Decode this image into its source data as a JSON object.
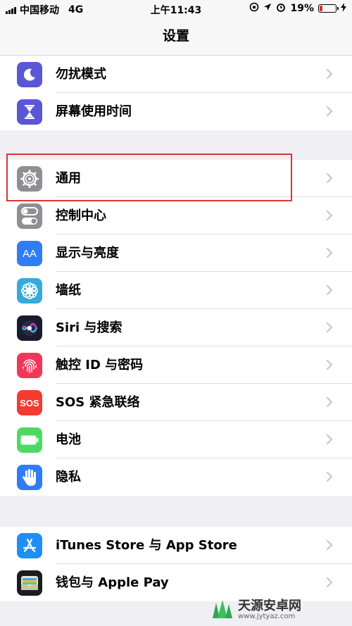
{
  "status_bar": {
    "carrier": "中国移动",
    "network": "4G",
    "time": "上午11:43",
    "battery_percent": "19%",
    "battery_level": 0.19
  },
  "nav": {
    "title": "设置"
  },
  "group1": [
    {
      "label": "勿扰模式",
      "icon": "moon-icon",
      "color": "#5a56d6"
    },
    {
      "label": "屏幕使用时间",
      "icon": "hourglass-icon",
      "color": "#5a56d6"
    }
  ],
  "group2": [
    {
      "label": "通用",
      "icon": "gear-icon",
      "color": "#8e8e93"
    },
    {
      "label": "控制中心",
      "icon": "toggles-icon",
      "color": "#8e8e93"
    },
    {
      "label": "显示与亮度",
      "icon": "text-size-icon",
      "color": "#2f7cf6",
      "icon_text": "AA"
    },
    {
      "label": "墙纸",
      "icon": "flower-icon",
      "color": "#36aadc"
    },
    {
      "label": "Siri 与搜索",
      "icon": "siri-icon",
      "color": "#1b1b2e"
    },
    {
      "label": "触控 ID 与密码",
      "icon": "fingerprint-icon",
      "color": "#f2365a"
    },
    {
      "label": "SOS 紧急联络",
      "icon": "sos-icon",
      "color": "#f33b30",
      "icon_text": "SOS"
    },
    {
      "label": "电池",
      "icon": "battery-icon",
      "color": "#4cd964"
    },
    {
      "label": "隐私",
      "icon": "hand-icon",
      "color": "#2f7cf6"
    }
  ],
  "group3": [
    {
      "label": "iTunes Store 与 App Store",
      "icon": "app-store-icon",
      "color": "#1f8ef6"
    },
    {
      "label": "钱包与 Apple Pay",
      "icon": "wallet-icon",
      "color": "#1c1c1e"
    }
  ],
  "watermark": {
    "title": "天源安卓网",
    "url": "www.jytyaz.com"
  }
}
